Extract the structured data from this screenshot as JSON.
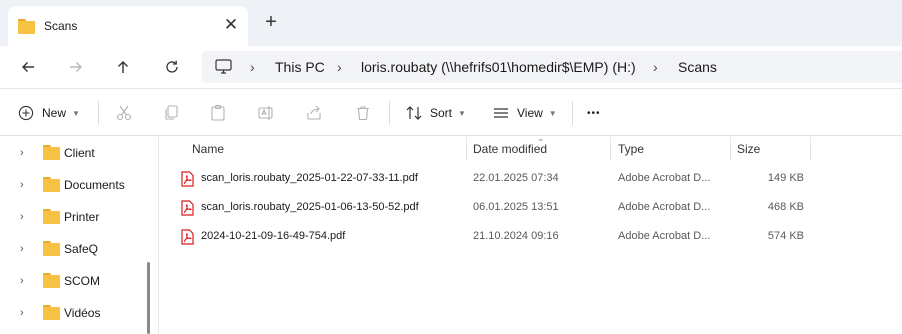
{
  "tab": {
    "title": "Scans",
    "close_glyph": "✕",
    "new_tab_glyph": "+"
  },
  "breadcrumb": {
    "items": [
      "This PC",
      "loris.roubaty (\\\\hefrifs01\\homedir$\\EMP) (H:)",
      "Scans"
    ],
    "separator": "›"
  },
  "toolbar": {
    "new_label": "New",
    "sort_label": "Sort",
    "view_label": "View",
    "more_glyph": "•••"
  },
  "sidebar": {
    "items": [
      {
        "label": "Client"
      },
      {
        "label": "Documents"
      },
      {
        "label": "Printer"
      },
      {
        "label": "SafeQ"
      },
      {
        "label": "SCOM"
      },
      {
        "label": "Vidéos"
      }
    ]
  },
  "columns": {
    "name": "Name",
    "date": "Date modified",
    "type": "Type",
    "size": "Size"
  },
  "files": [
    {
      "name": "scan_loris.roubaty_2025-01-22-07-33-11.pdf",
      "date": "22.01.2025 07:34",
      "type": "Adobe Acrobat D...",
      "size": "149 KB"
    },
    {
      "name": "scan_loris.roubaty_2025-01-06-13-50-52.pdf",
      "date": "06.01.2025 13:51",
      "type": "Adobe Acrobat D...",
      "size": "468 KB"
    },
    {
      "name": "2024-10-21-09-16-49-754.pdf",
      "date": "21.10.2024 09:16",
      "type": "Adobe Acrobat D...",
      "size": "574 KB"
    }
  ],
  "icons": {
    "folder": "folder-icon",
    "pdf": "pdf-file-icon",
    "back": "arrow-left-icon",
    "forward": "arrow-right-icon",
    "up": "arrow-up-icon",
    "refresh": "refresh-icon",
    "computer": "computer-icon"
  },
  "colors": {
    "folder": "#f5c242",
    "pdf": "#d81e1e",
    "tab_strip": "#eef1f6",
    "address_bg": "#f3f4f7"
  }
}
